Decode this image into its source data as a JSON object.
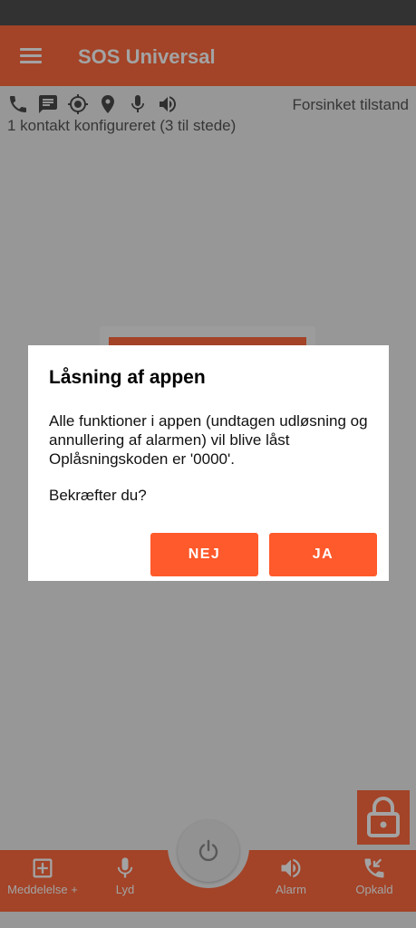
{
  "app": {
    "title": "SOS Universal"
  },
  "status_row": {
    "icons": [
      "phone-icon",
      "message-icon",
      "location-target-icon",
      "place-pin-icon",
      "microphone-icon",
      "speaker-icon"
    ],
    "mode": "Forsinket tilstand",
    "contacts": "1 kontakt konfigureret (3 til stede)"
  },
  "bottom_nav": {
    "messages": "Meddelelse +",
    "sound": "Lyd",
    "alarm": "Alarm",
    "call": "Opkald"
  },
  "dialog": {
    "title": "Låsning af appen",
    "body_line1": "Alle funktioner i appen (undtagen udløsning og annullering af alarmen) vil blive låst",
    "body_line2": "Oplåsningskoden er '0000'.",
    "question": "Bekræfter du?",
    "no": "NEJ",
    "yes": "JA"
  },
  "colors": {
    "accent": "#ff6a3d",
    "button": "#ff5a2b",
    "statusbar": "#4f4f4f"
  }
}
